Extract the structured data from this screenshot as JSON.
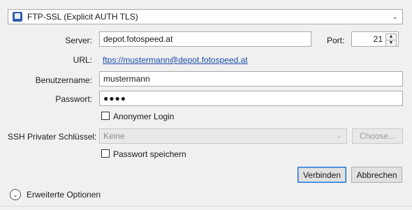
{
  "protocol": {
    "value": "FTP-SSL (Explicit AUTH TLS)",
    "icon": "ftp-lock-icon"
  },
  "server": {
    "label": "Server:",
    "value": "depot.fotospeed.at"
  },
  "port": {
    "label": "Port:",
    "value": "21"
  },
  "url": {
    "label": "URL:",
    "value": "ftps://mustermann@depot.fotospeed.at"
  },
  "username": {
    "label": "Benutzername:",
    "value": "mustermann"
  },
  "password": {
    "label": "Passwort:",
    "value": "●●●●"
  },
  "anonymous_login": {
    "label": "Anonymer Login",
    "checked": false
  },
  "ssh_key": {
    "label": "SSH Privater Schlüssel:",
    "value": "Keine",
    "choose_label": "Choose..."
  },
  "save_password": {
    "label": "Passwort speichern",
    "checked": false
  },
  "buttons": {
    "connect": "Verbinden",
    "cancel": "Abbrechen"
  },
  "advanced": {
    "label": "Erweiterte Optionen"
  },
  "colors": {
    "link": "#1a4ea8",
    "default_button_border": "#1f6fd1"
  }
}
